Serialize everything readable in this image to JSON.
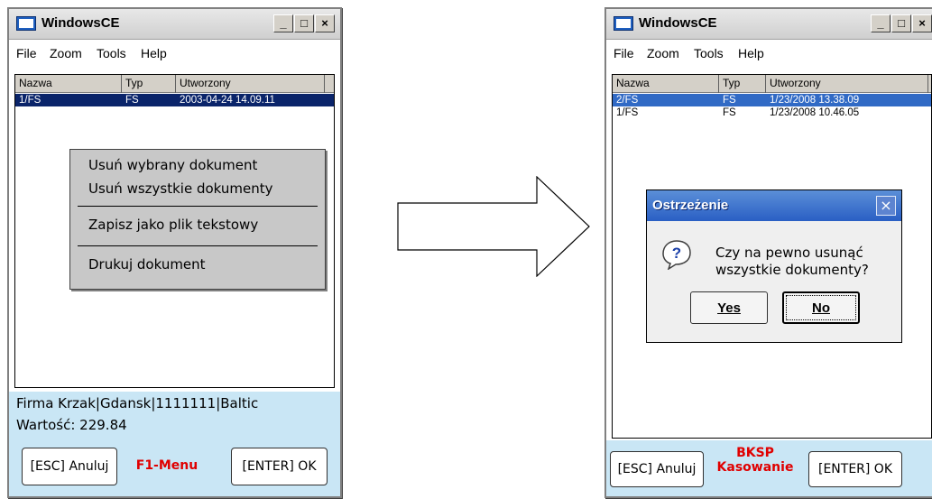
{
  "left_window": {
    "title": "WindowsCE",
    "title_buttons": [
      "_",
      "□",
      "×"
    ],
    "menu": [
      "File",
      "Zoom",
      "Tools",
      "Help"
    ],
    "columns": [
      "Nazwa",
      "Typ",
      "Utworzony"
    ],
    "rows": [
      {
        "nazwa": "1/FS",
        "typ": "FS",
        "utworzony": "2003-04-24 14.09.11",
        "selected": true
      }
    ],
    "context_menu": {
      "items": [
        "Usuń wybrany dokument",
        "Usuń wszystkie dokumenty",
        "Zapisz jako plik tekstowy",
        "Drukuj dokument"
      ]
    },
    "status": {
      "line1": "Firma Krzak|Gdansk|1111111|Baltic",
      "line2": "Wartość: 229.84"
    },
    "buttons": {
      "esc": "[ESC] Anuluj",
      "f1": "F1-Menu",
      "enter": "[ENTER] OK"
    }
  },
  "right_window": {
    "title": "WindowsCE",
    "title_buttons": [
      "_",
      "□",
      "×"
    ],
    "menu": [
      "File",
      "Zoom",
      "Tools",
      "Help"
    ],
    "columns": [
      "Nazwa",
      "Typ",
      "Utworzony"
    ],
    "rows": [
      {
        "nazwa": "2/FS",
        "typ": "FS",
        "utworzony": "1/23/2008 13.38.09",
        "selected": true
      },
      {
        "nazwa": "1/FS",
        "typ": "FS",
        "utworzony": "1/23/2008 10.46.05",
        "selected": false
      }
    ],
    "dialog": {
      "title": "Ostrzeżenie",
      "close": "×",
      "icon": "question-icon",
      "message_line1": "Czy na pewno usunąć",
      "message_line2": "wszystkie dokumenty?",
      "yes_label": "Yes",
      "no_label": "No"
    },
    "buttons": {
      "esc": "[ESC] Anuluj",
      "bksp_line1": "BKSP",
      "bksp_line2": "Kasowanie",
      "enter": "[ENTER] OK"
    }
  },
  "colors": {
    "selection": "#0a246a",
    "bottom_panel": "#c9e6f5",
    "red_label": "#e00000",
    "dialog_title": "#2a5fc4"
  }
}
